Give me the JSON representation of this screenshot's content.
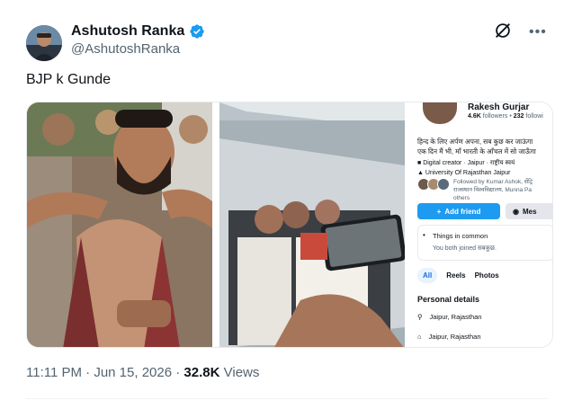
{
  "author": {
    "name": "Ashutosh Ranka",
    "handle": "@AshutoshRanka"
  },
  "tweet": {
    "text": "BJP k Gunde",
    "time": "11:11 PM",
    "separator": "·",
    "date": "Jun 15, 2026",
    "views_count": "32.8K",
    "views_label": "Views"
  },
  "profile_card": {
    "name": "Rakesh Gurjar",
    "followers": "4.6K",
    "followers_label": "followers",
    "following": "232",
    "following_label": "followi",
    "bio_line1": "हिन्द के लिए अर्पण अपना, सब कुछ कर जाऊंगा",
    "bio_line2": "एक दिन मैं भी, माँ भारती के आँचल में सो जाऊँगा",
    "tag_line1": "Digital creator · Jaipur · राष्ट्रीय स्वयं",
    "tag_line2": "University Of Rajasthan Jaipur",
    "followed_line1": "Followed by Kumar Ashok, सेंट्रि",
    "followed_line2": "राजस्थान विश्वविद्यालय, Munna Pa",
    "followed_line3": "others",
    "add_friend": "Add friend",
    "message": "Mes",
    "common_title": "Things in common",
    "common_sub": "You both joined सबकुछ.",
    "tabs": [
      "All",
      "Reels",
      "Photos"
    ],
    "personal_title": "Personal details",
    "locations": [
      "Jaipur, Rajasthan",
      "Jaipur, Rajasthan"
    ]
  },
  "colors": {
    "accent": "#1d9bf0",
    "text": "#0f1419",
    "muted": "#536471"
  }
}
